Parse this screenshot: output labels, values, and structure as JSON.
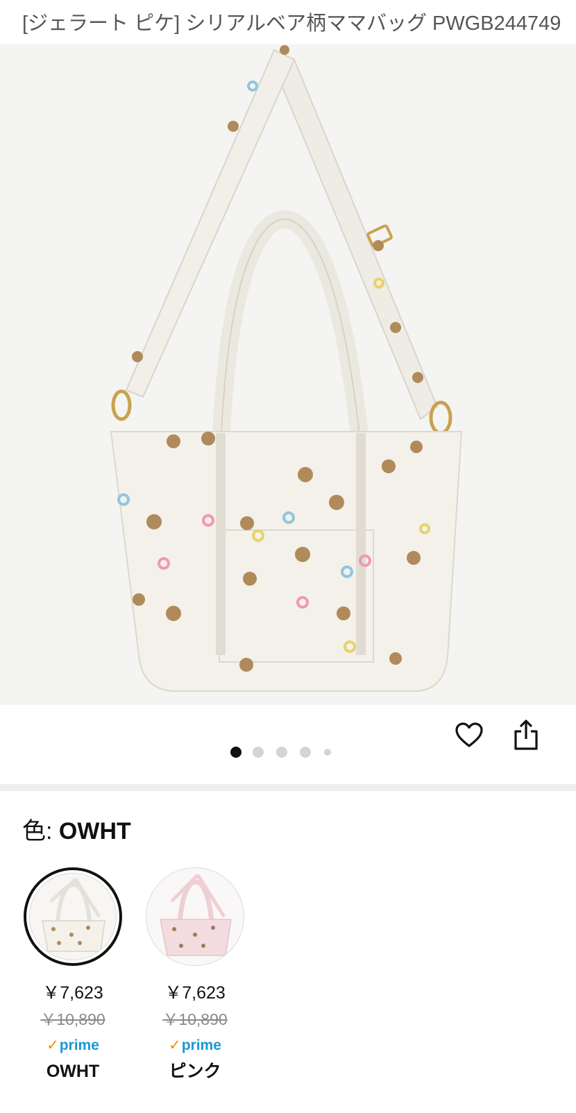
{
  "product": {
    "title": "[ジェラート ピケ] シリアルベア柄ママバッグ PWGB244749"
  },
  "gallery": {
    "image_count": 5,
    "active_index": 0,
    "favorite_icon": "heart-outline-icon",
    "share_icon": "share-icon"
  },
  "color_selector": {
    "label": "色: ",
    "selected_value": "OWHT",
    "options": [
      {
        "name": "OWHT",
        "price": "￥7,623",
        "list_price": "￥10,890",
        "prime_check": "✓",
        "prime_label": "prime",
        "selected": true,
        "bag_color": "#f3f1ea"
      },
      {
        "name": "ピンク",
        "price": "￥7,623",
        "list_price": "￥10,890",
        "prime_check": "✓",
        "prime_label": "prime",
        "selected": false,
        "bag_color": "#f3dcdf"
      }
    ]
  },
  "colors": {
    "prime_blue": "#1a98d5",
    "prime_check_orange": "#f08c00",
    "dot_active": "#111111",
    "dot_inactive": "#d4d4d4"
  }
}
